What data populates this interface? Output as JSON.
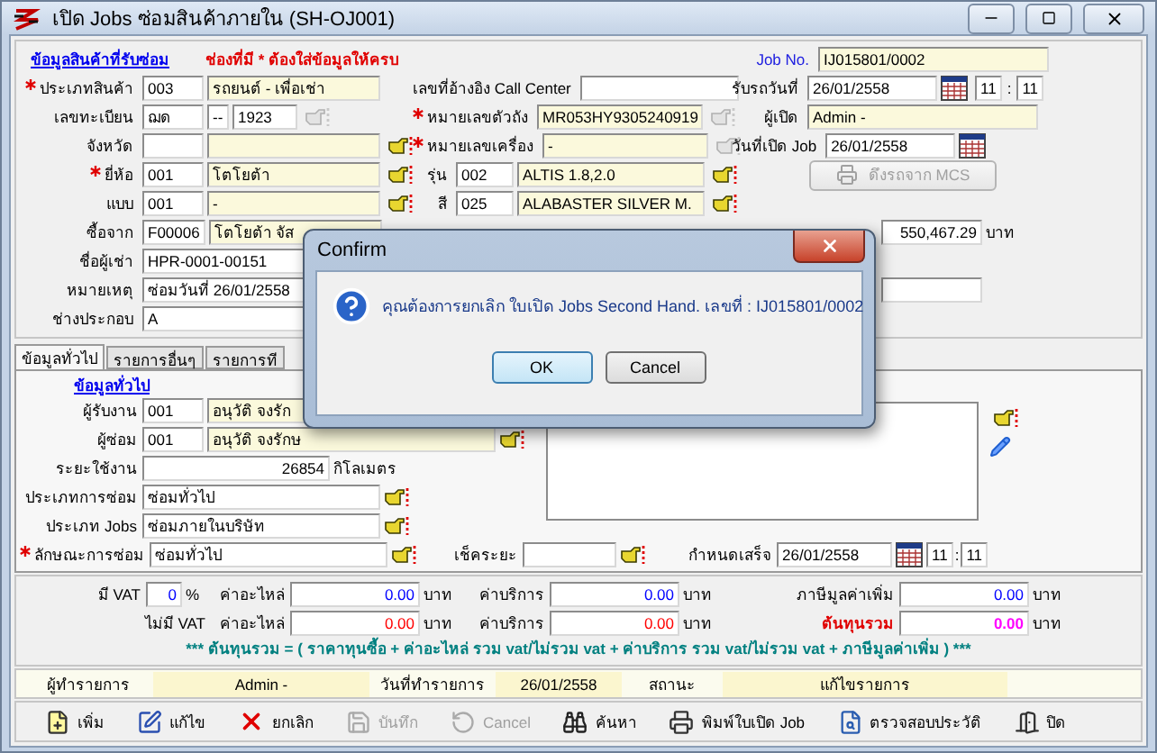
{
  "window": {
    "title": "เปิด Jobs ซ่อมสินค้าภายใน (SH-OJ001)"
  },
  "product": {
    "link": "ข้อมูลสินค้าที่รับซ่อม",
    "note": "ช่องที่มี * ต้องใส่ข้อมูลให้ครบ",
    "type": {
      "label": "ประเภทสินค้า",
      "required": true,
      "code": "003",
      "name": "รถยนต์ - เพื่อเช่า"
    },
    "plate": {
      "label": "เลขทะเบียน",
      "prefix": "ฌด",
      "separator": "--",
      "number": "1923",
      "picker_enabled": false
    },
    "province": {
      "label": "จังหวัด",
      "picker_enabled": true
    },
    "brand": {
      "label": "ยี่ห้อ",
      "required": true,
      "code": "001",
      "name": "โตโยต้า",
      "picker_enabled": true
    },
    "style": {
      "label": "แบบ",
      "code": "001",
      "name": "-",
      "picker_enabled": true
    },
    "bought_from": {
      "label": "ซื้อจาก",
      "code": "F00006",
      "name": "โตโยต้า จัส"
    },
    "renter": {
      "label": "ชื่อผู้เช่า",
      "value": "HPR-0001-00151"
    },
    "remark": {
      "label": "หมายเหตุ",
      "value": "ซ่อมวันที่ 26/01/2558"
    },
    "assembler": {
      "label": "ช่างประกอบ",
      "value": "A"
    },
    "call_center": {
      "label": "เลขที่อ้างอิง Call Center"
    },
    "chassis": {
      "label": "หมายเลขตัวถัง",
      "required": true,
      "value": "MR053HY9305240919",
      "picker_enabled": false
    },
    "engine": {
      "label": "หมายเลขเครื่อง",
      "required": true,
      "value": "-",
      "picker_enabled": false
    },
    "model": {
      "label": "รุ่น",
      "code": "002",
      "name": "ALTIS 1.8,2.0",
      "picker_enabled": true
    },
    "color": {
      "label": "สี",
      "code": "025",
      "name": "ALABASTER SILVER M.",
      "picker_enabled": true
    },
    "price": {
      "value": "550,467.29",
      "unit": "บาท"
    }
  },
  "job": {
    "no_label": "Job No.",
    "no": "IJ015801/0002",
    "received_label": "รับรถวันที่",
    "received_date": "26/01/2558",
    "received_time": {
      "hour": "11",
      "separator": ":",
      "minute": "11"
    },
    "opener_label": "ผู้เปิด",
    "opener": "Admin -",
    "opened_label": "วันที่เปิด Job",
    "opened_date": "26/01/2558",
    "mcs_button": {
      "label": "ดึงรถจาก MCS",
      "disabled": true
    }
  },
  "tabs": [
    {
      "label": "ข้อมูลทั่วไป",
      "selected": true
    },
    {
      "label": "รายการอื่นๆ",
      "selected": false
    },
    {
      "label": "รายการที",
      "selected": false
    }
  ],
  "general": {
    "link": "ข้อมูลทั่วไป",
    "receiver": {
      "label": "ผู้รับงาน",
      "code": "001",
      "name": "อนุวัติ จงรัก"
    },
    "repairer": {
      "label": "ผู้ซ่อม",
      "code": "001",
      "name": "อนุวัติ จงรักษ"
    },
    "mileage": {
      "label": "ระยะใช้งาน",
      "value": "26854",
      "unit": "กิโลเมตร"
    },
    "repair_type": {
      "label": "ประเภทการซ่อม",
      "value": "ซ่อมทั่วไป"
    },
    "job_type": {
      "label": "ประเภท Jobs",
      "value": "ซ่อมภายในบริษัท"
    },
    "repair_nature": {
      "label": "ลักษณะการซ่อม",
      "required": true,
      "value": "ซ่อมทั่วไป"
    },
    "check_distance": {
      "label": "เช็คระยะ"
    },
    "due": {
      "label": "กำหนดเสร็จ",
      "date": "26/01/2558",
      "hour": "11",
      "separator": ":",
      "minute": "11"
    }
  },
  "cost_rows": [
    {
      "kind": "vat",
      "label": "มี VAT",
      "rate": "0",
      "rate_unit": "%",
      "parts_label": "ค่าอะไหล่",
      "parts": "0.00",
      "parts_unit": "บาท",
      "service_label": "ค่าบริการ",
      "service": "0.00",
      "service_unit": "บาท",
      "total_label": "ภาษีมูลค่าเพิ่ม",
      "total": "0.00",
      "total_unit": "บาท"
    },
    {
      "kind": "no_vat",
      "label": "ไม่มี VAT",
      "parts_label": "ค่าอะไหล่",
      "parts": "0.00",
      "parts_unit": "บาท",
      "service_label": "ค่าบริการ",
      "service": "0.00",
      "service_unit": "บาท",
      "total_label": "ต้นทุนรวม",
      "total": "0.00",
      "total_unit": "บาท"
    }
  ],
  "formula": "***  ต้นทุนรวม = ( ราคาทุนซื้อ  +  ค่าอะไหล่ รวม vat/ไม่รวม vat  +  ค่าบริการ รวม vat/ไม่รวม vat  +  ภาษีมูลค่าเพิ่ม )  ***",
  "status_bar": {
    "user_label": "ผู้ทำรายการ",
    "user": "Admin -",
    "date_label": "วันที่ทำรายการ",
    "date": "26/01/2558",
    "state_label": "สถานะ",
    "state": "แก้ไขรายการ"
  },
  "toolbar": [
    {
      "kind": "add",
      "label": "เพิ่ม",
      "disabled": false
    },
    {
      "kind": "edit",
      "label": "แก้ไข",
      "disabled": false
    },
    {
      "kind": "delete",
      "label": "ยกเลิก",
      "disabled": false
    },
    {
      "kind": "save",
      "label": "บันทึก",
      "disabled": true
    },
    {
      "kind": "undo",
      "label": "Cancel",
      "disabled": true
    },
    {
      "kind": "search",
      "label": "ค้นหา",
      "disabled": false
    },
    {
      "kind": "print",
      "label": "พิมพ์ใบเปิด Job",
      "disabled": false
    },
    {
      "kind": "history",
      "label": "ตรวจสอบประวัติ",
      "disabled": false
    },
    {
      "kind": "exit",
      "label": "ปิด",
      "disabled": false
    }
  ],
  "dialog": {
    "title": "Confirm",
    "message": "คุณต้องการยกเลิก ใบเปิด Jobs Second Hand. เลขที่ : IJ015801/0002",
    "buttons": [
      "OK",
      "Cancel"
    ]
  }
}
